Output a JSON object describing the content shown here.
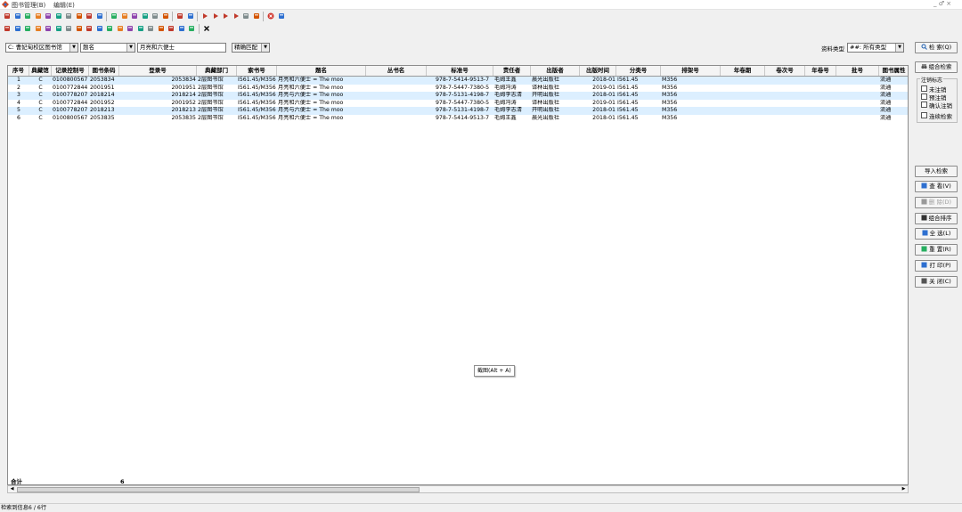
{
  "window": {
    "menus": [
      "图书管理(B)",
      "编辑(E)"
    ],
    "controls": "_ ♂ ×"
  },
  "toolbar": {
    "row1_icons": [
      "list-icon",
      "grid-icon",
      "books-icon",
      "tree-icon",
      "color-wheel-icon",
      "doc-icon",
      "barcode-icon",
      "search-doc-icon",
      "print-preview-icon",
      "copy-icon",
      "paste-icon",
      "green-circle-icon",
      "money-icon",
      "tag-icon",
      "brush-icon",
      "monitor-icon",
      "window-icon",
      "refresh-icon",
      "first-record-icon",
      "prev-record-icon",
      "next-record-icon",
      "last-record-icon",
      "export-icon",
      "image-icon",
      "stop-icon",
      "exit-icon"
    ],
    "row2_icons": [
      "folder-icon",
      "coins-icon",
      "gift-icon",
      "chart-icon",
      "shield-icon",
      "book-red-icon",
      "book-blue-icon",
      "arrows-icon",
      "wrench-icon",
      "delete-icon",
      "trash-icon",
      "no-icon",
      "eraser-icon",
      "pin-icon",
      "cut-icon",
      "tag-icon",
      "grid-icon",
      "play-icon",
      "save-icon",
      "close-icon"
    ]
  },
  "search": {
    "library_select": "C: 曹妃甸校区图书馆",
    "field_select": "题名",
    "query_value": "月亮和六便士",
    "match_select": "精确匹配",
    "type_label": "资料类型",
    "type_select": "##: 所有类型",
    "search_button": "检 索(Q)"
  },
  "table": {
    "columns": [
      "序号",
      "典藏馆",
      "记录控制号",
      "图书条码",
      "登录号",
      "典藏部门",
      "索书号",
      "题名",
      "丛书名",
      "标准号",
      "责任者",
      "出版者",
      "出版时间",
      "分类号",
      "排架号",
      "年卷期",
      "卷次号",
      "年卷号",
      "批号",
      "图书属性"
    ],
    "rows": [
      {
        "no": "1",
        "lib": "C",
        "ctrl": "0100800567",
        "barcode": "2053834",
        "reg": "2053834",
        "dept": "2层图书馆",
        "call": "I561.45/M356",
        "title": "月亮和六便士 = The moo",
        "series": "",
        "isbn": "978-7-5414-9513-7",
        "author": "毛姆王鑫",
        "pub": "晨光出版社",
        "date": "2018-01",
        "cls": "I561.45",
        "shelf": "M356",
        "attr": "流通"
      },
      {
        "no": "2",
        "lib": "C",
        "ctrl": "0100772844",
        "barcode": "2001951",
        "reg": "2001951",
        "dept": "2层图书馆",
        "call": "I561.45/M356",
        "title": "月亮和六便士 = The moo",
        "series": "",
        "isbn": "978-7-5447-7380-5",
        "author": "毛姆冯涛",
        "pub": "译林出版社",
        "date": "2019-01",
        "cls": "I561.45",
        "shelf": "M356",
        "attr": "流通"
      },
      {
        "no": "3",
        "lib": "C",
        "ctrl": "0100778207",
        "barcode": "2018214",
        "reg": "2018214",
        "dept": "2层图书馆",
        "call": "I561.45/M356",
        "title": "月亮与六便士 = The moo",
        "series": "",
        "isbn": "978-7-5131-4198-7",
        "author": "毛姆李志清",
        "pub": "开明出版社",
        "date": "2018-01",
        "cls": "I561.45",
        "shelf": "M356",
        "attr": "流通"
      },
      {
        "no": "4",
        "lib": "C",
        "ctrl": "0100772844",
        "barcode": "2001952",
        "reg": "2001952",
        "dept": "2层图书馆",
        "call": "I561.45/M356",
        "title": "月亮和六便士 = The moo",
        "series": "",
        "isbn": "978-7-5447-7380-5",
        "author": "毛姆冯涛",
        "pub": "译林出版社",
        "date": "2019-01",
        "cls": "I561.45",
        "shelf": "M356",
        "attr": "流通"
      },
      {
        "no": "5",
        "lib": "C",
        "ctrl": "0100778207",
        "barcode": "2018213",
        "reg": "2018213",
        "dept": "2层图书馆",
        "call": "I561.45/M356",
        "title": "月亮与六便士 = The moo",
        "series": "",
        "isbn": "978-7-5131-4198-7",
        "author": "毛姆李志清",
        "pub": "开明出版社",
        "date": "2018-01",
        "cls": "I561.45",
        "shelf": "M356",
        "attr": "流通"
      },
      {
        "no": "6",
        "lib": "C",
        "ctrl": "0100800567",
        "barcode": "2053835",
        "reg": "2053835",
        "dept": "2层图书馆",
        "call": "I561.45/M356",
        "title": "月亮和六便士 = The moo",
        "series": "",
        "isbn": "978-7-5414-9513-7",
        "author": "毛姆王鑫",
        "pub": "晨光出版社",
        "date": "2018-01",
        "cls": "I561.45",
        "shelf": "M356",
        "attr": "流通"
      }
    ],
    "total_label": "合计",
    "total_value": "6"
  },
  "sidebar": {
    "combo_search": "组合检索",
    "group_title": "注销标志",
    "checks": [
      "未注销",
      "预注销",
      "确认注销",
      "连续检索"
    ],
    "buttons": [
      "导入检索",
      "查 看(V)",
      "删 除(D)",
      "组合排序",
      "全 选(L)",
      "重 置(R)",
      "打 印(P)",
      "关 闭(C)"
    ]
  },
  "tooltip": "截图(Alt + A)",
  "status": "检索到信息6 / 6行"
}
